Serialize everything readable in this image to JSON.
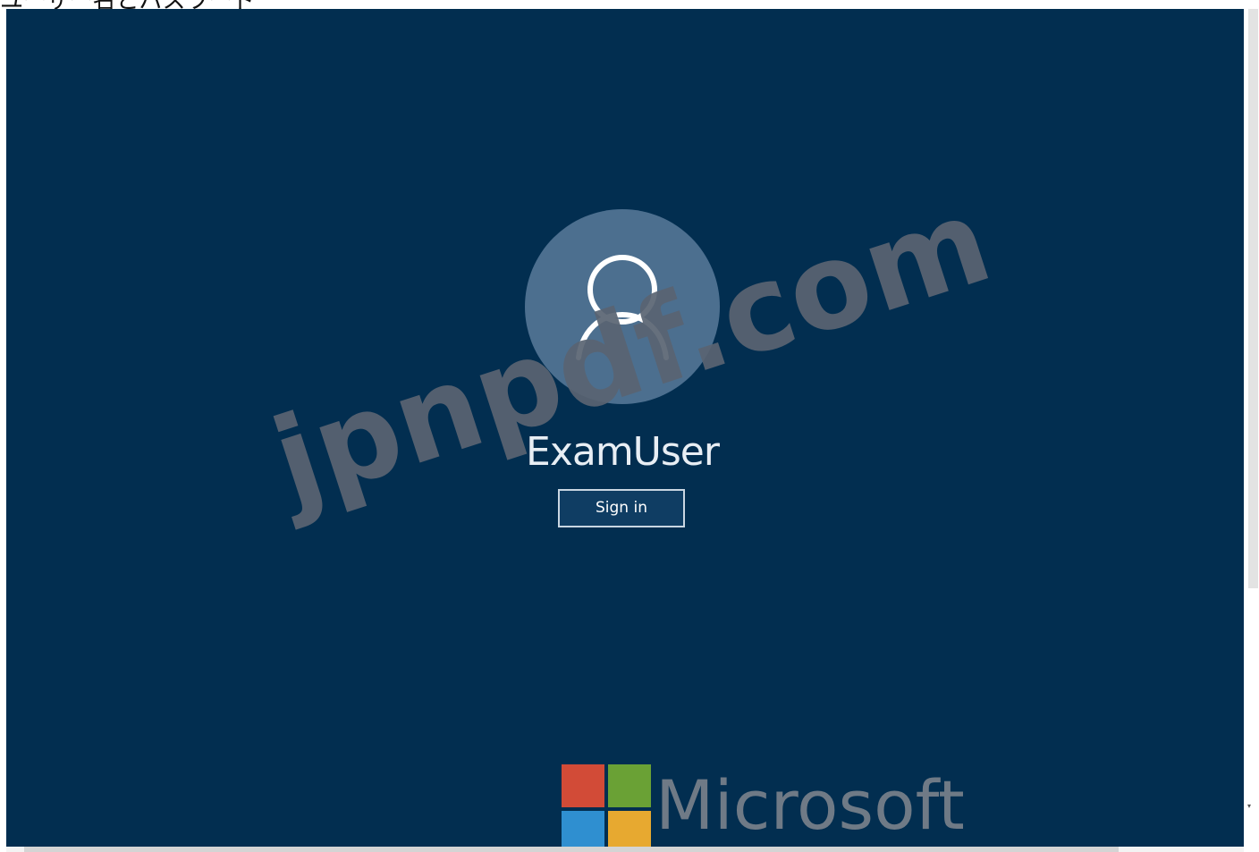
{
  "header": {
    "label": "ユーザー名とパスワード"
  },
  "login": {
    "username": "ExamUser",
    "signin_label": "Sign in",
    "avatar_icon": "user-icon",
    "background_color": "#022e50"
  },
  "watermark": {
    "text": "jpnpdf.com"
  },
  "branding": {
    "wordmark": "Microsoft",
    "logo_colors": [
      "#d24b37",
      "#6aa135",
      "#2f8fd0",
      "#e7a930"
    ]
  },
  "scrollbars": {
    "vertical_arrow": "▾"
  }
}
